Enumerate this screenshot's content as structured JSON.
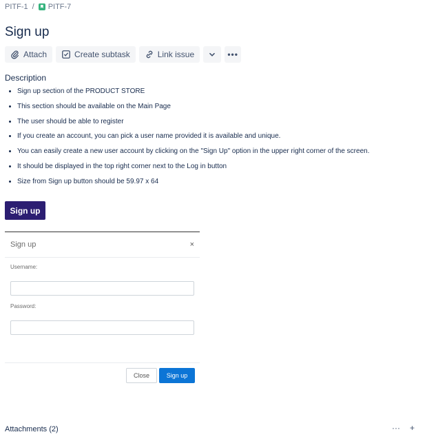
{
  "breadcrumb": {
    "parent": "PITF-1",
    "separator": "/",
    "current": "PITF-7",
    "current_icon": "story-icon"
  },
  "issue": {
    "title": "Sign up"
  },
  "toolbar": {
    "attach": "Attach",
    "attach_icon": "paperclip-icon",
    "create_subtask": "Create subtask",
    "subtask_icon": "subtask-icon",
    "link_issue": "Link issue",
    "link_icon": "link-icon",
    "dropdown_icon": "chevron-down-icon",
    "more_label": "•••"
  },
  "description": {
    "label": "Description",
    "items": [
      "Sign up section of the PRODUCT STORE",
      "This section should be available on the Main Page",
      "The user should be able to register",
      "If you create an account, you can pick a user name provided it is available and unique.",
      "You can easily create a new user account by clicking on the \"Sign Up\" option in the upper right corner of the screen.",
      "It should be displayed in the top right corner next to the Log in button",
      "Size from Sign up button should be 59.97 x 64"
    ],
    "sample_button": "Sign up"
  },
  "modal": {
    "title": "Sign up",
    "close_symbol": "×",
    "username_label": "Username:",
    "username_value": "",
    "password_label": "Password:",
    "password_value": "",
    "close_button": "Close",
    "submit_button": "Sign up"
  },
  "attachments": {
    "label": "Attachments (2)",
    "more_label": "···",
    "add_label": "+"
  },
  "colors": {
    "sample_button_bg": "#2c1e72",
    "submit_button_bg": "#0c75d6",
    "story_icon": "#36b37e"
  }
}
